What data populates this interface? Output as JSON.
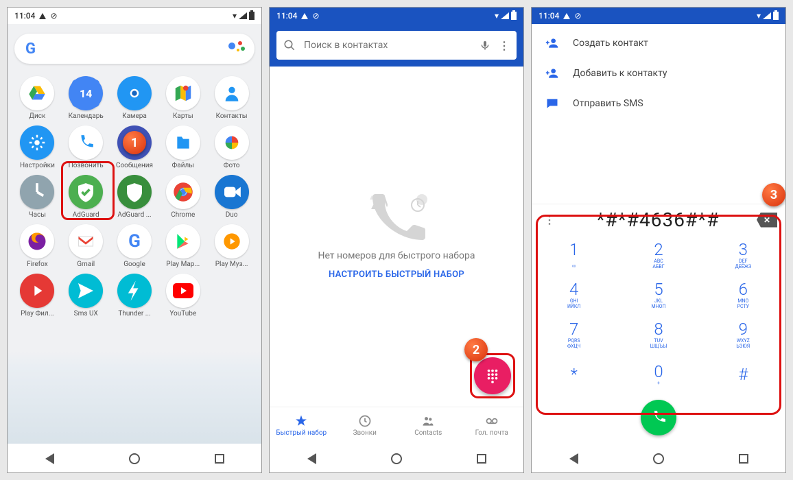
{
  "status": {
    "time": "11:04"
  },
  "screen1": {
    "apps": [
      {
        "label": "Диск",
        "bg": "#fff"
      },
      {
        "label": "Календарь",
        "bg": "#4285F4"
      },
      {
        "label": "Камера",
        "bg": "#2196F3"
      },
      {
        "label": "Карты",
        "bg": "#fff"
      },
      {
        "label": "Контакты",
        "bg": "#fff"
      },
      {
        "label": "Настройки",
        "bg": "#2196F3"
      },
      {
        "label": "Позвонить",
        "bg": "#fff"
      },
      {
        "label": "Сообщения",
        "bg": "#3F51B5"
      },
      {
        "label": "Файлы",
        "bg": "#fff"
      },
      {
        "label": "Фото",
        "bg": "#fff"
      },
      {
        "label": "Часы",
        "bg": "#90A4AE"
      },
      {
        "label": "AdGuard",
        "bg": "#4CAF50"
      },
      {
        "label": "AdGuard ...",
        "bg": "#388E3C"
      },
      {
        "label": "Chrome",
        "bg": "#fff"
      },
      {
        "label": "Duo",
        "bg": "#1976D2"
      },
      {
        "label": "Firefox",
        "bg": "#fff"
      },
      {
        "label": "Gmail",
        "bg": "#fff"
      },
      {
        "label": "Google",
        "bg": "#fff"
      },
      {
        "label": "Play Мар...",
        "bg": "#fff"
      },
      {
        "label": "Play Муз...",
        "bg": "#fff"
      },
      {
        "label": "Play Фил...",
        "bg": "#E53935"
      },
      {
        "label": "Sms UX",
        "bg": "#00BCD4"
      },
      {
        "label": "Thunder ...",
        "bg": "#00BCD4"
      },
      {
        "label": "YouTube",
        "bg": "#fff"
      }
    ]
  },
  "screen2": {
    "search_placeholder": "Поиск в контактах",
    "empty_title": "Нет номеров для быстрого набора",
    "empty_link": "НАСТРОИТЬ БЫСТРЫЙ НАБОР",
    "tabs": [
      {
        "label": "Быстрый набор"
      },
      {
        "label": "Звонки"
      },
      {
        "label": "Contacts"
      },
      {
        "label": "Гол. почта"
      }
    ]
  },
  "screen3": {
    "menu": [
      {
        "label": "Создать контакт"
      },
      {
        "label": "Добавить к контакту"
      },
      {
        "label": "Отправить SMS"
      }
    ],
    "dialed": "*#*#4636#*#",
    "keys": [
      {
        "d": "1",
        "l1": "",
        "l2": "ᵒᵒ"
      },
      {
        "d": "2",
        "l1": "ABC",
        "l2": "АБВГ"
      },
      {
        "d": "3",
        "l1": "DEF",
        "l2": "ДЕЁЖЗ"
      },
      {
        "d": "4",
        "l1": "GHI",
        "l2": "ИЙКЛ"
      },
      {
        "d": "5",
        "l1": "JKL",
        "l2": "МНОП"
      },
      {
        "d": "6",
        "l1": "MNO",
        "l2": "РСТУ"
      },
      {
        "d": "7",
        "l1": "PQRS",
        "l2": "ФХЦЧ"
      },
      {
        "d": "8",
        "l1": "TUV",
        "l2": "ШЩЪЫ"
      },
      {
        "d": "9",
        "l1": "WXYZ",
        "l2": "ЬЭЮЯ"
      },
      {
        "d": "*",
        "l1": "",
        "l2": ""
      },
      {
        "d": "0",
        "l1": "+",
        "l2": ""
      },
      {
        "d": "#",
        "l1": "",
        "l2": ""
      }
    ]
  },
  "badges": {
    "b1": "1",
    "b2": "2",
    "b3": "3"
  }
}
